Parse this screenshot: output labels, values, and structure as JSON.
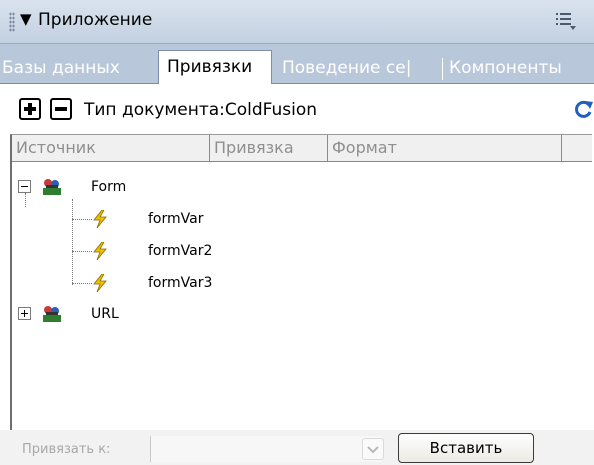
{
  "panel": {
    "title": "Приложение",
    "collapse_arrow": "▼",
    "options_icon": "panel-options-icon"
  },
  "tabs": [
    {
      "label": "Базы данных",
      "active": false
    },
    {
      "label": "Привязки",
      "active": true
    },
    {
      "label": "Поведение се|",
      "active": false
    },
    {
      "label": "Компоненты",
      "active": false
    }
  ],
  "toolbar": {
    "add_icon": "plus-icon",
    "remove_icon": "minus-icon",
    "doc_type_label": "Тип документа:",
    "doc_type_value": "ColdFusion",
    "refresh_icon": "refresh-icon"
  },
  "columns": [
    "Источник",
    "Привязка",
    "Формат"
  ],
  "tree": [
    {
      "label": "Form",
      "expanded": true,
      "icon": "data-source-icon",
      "children": [
        "formVar",
        "formVar2",
        "formVar3"
      ]
    },
    {
      "label": "URL",
      "expanded": false,
      "icon": "data-source-icon",
      "children": []
    }
  ],
  "footer": {
    "bind_to_label": "Привязать к:",
    "insert_button": "Вставить"
  },
  "colors": {
    "title_bg": "#c3d0e0",
    "tab_bg": "#b8c7da",
    "bolt": "#f0c000"
  }
}
